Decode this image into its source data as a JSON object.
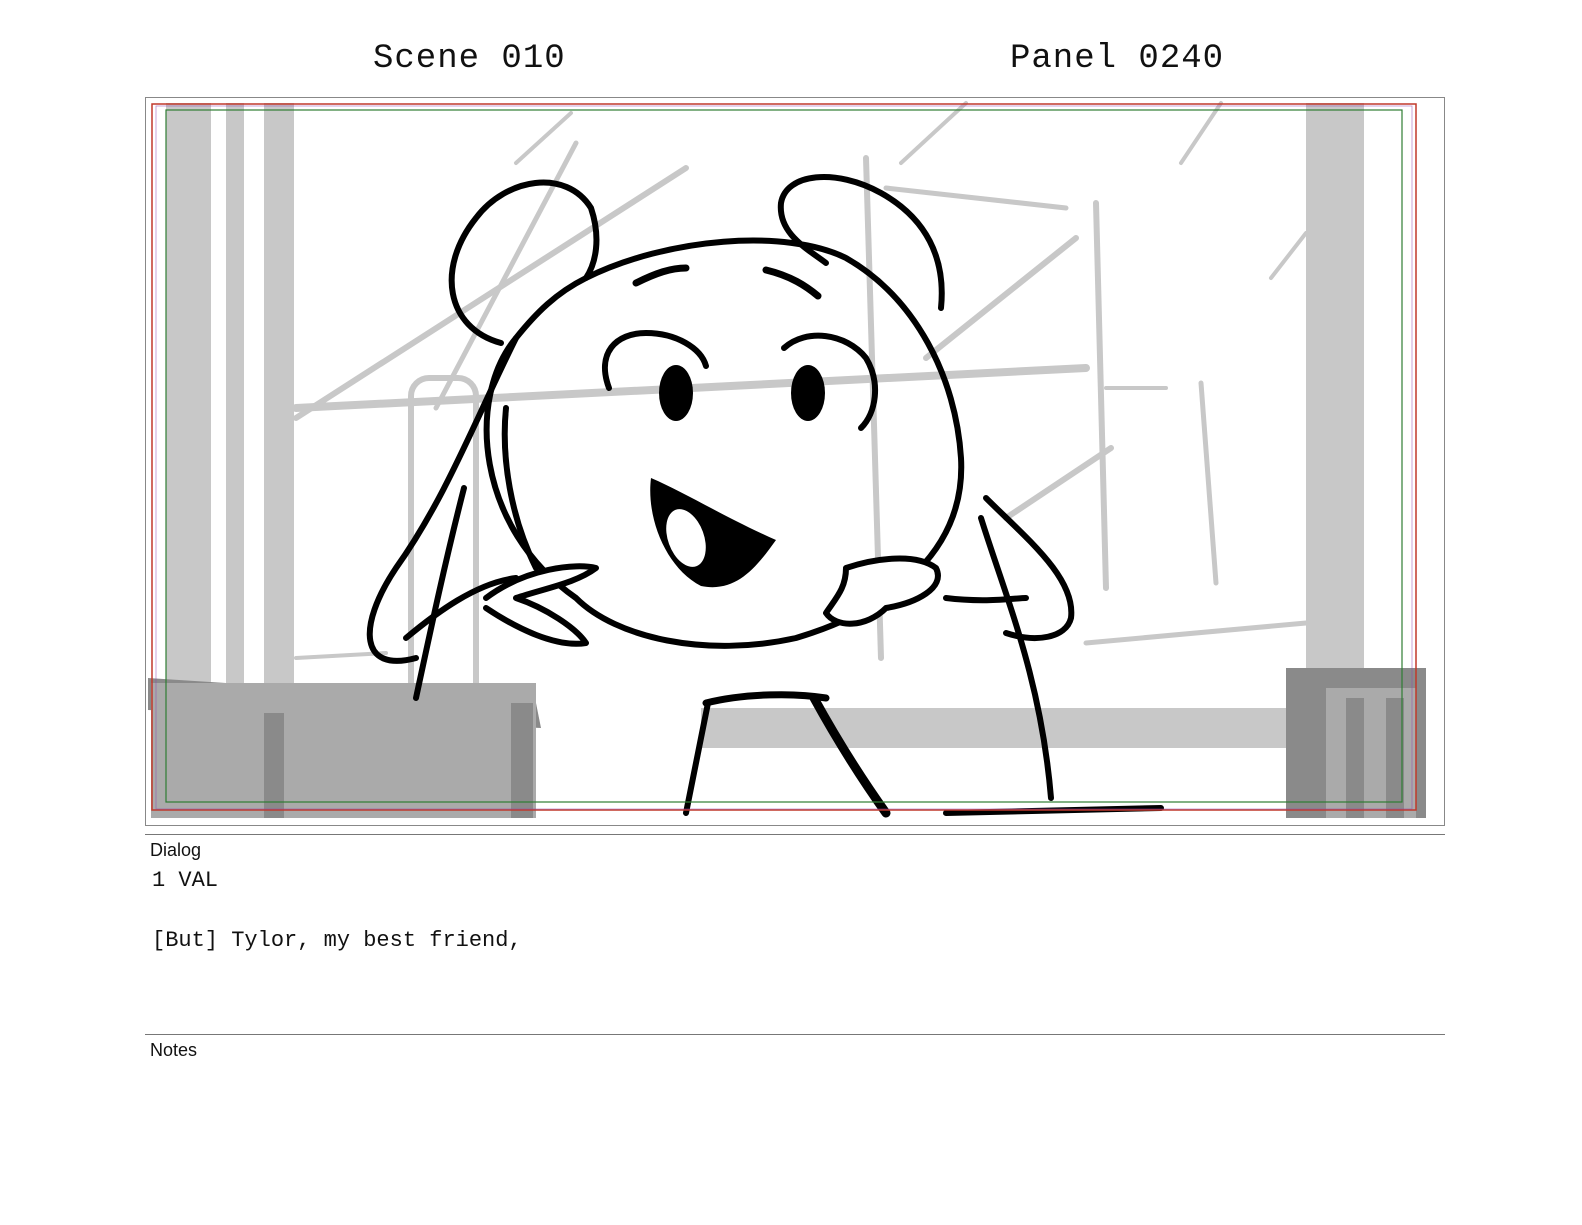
{
  "header": {
    "scene": "Scene 010",
    "panel": "Panel 0240"
  },
  "dialog": {
    "label": "Dialog",
    "character": "1 VAL",
    "line": "[But] Tylor, my best friend,"
  },
  "notes": {
    "label": "Notes",
    "text": ""
  },
  "colors": {
    "safe_outer": "#c0392b",
    "safe_inner": "#2e7d32",
    "sketch_light": "#c8c8c8",
    "sketch_mid": "#8a8a8a",
    "ink": "#000000"
  }
}
